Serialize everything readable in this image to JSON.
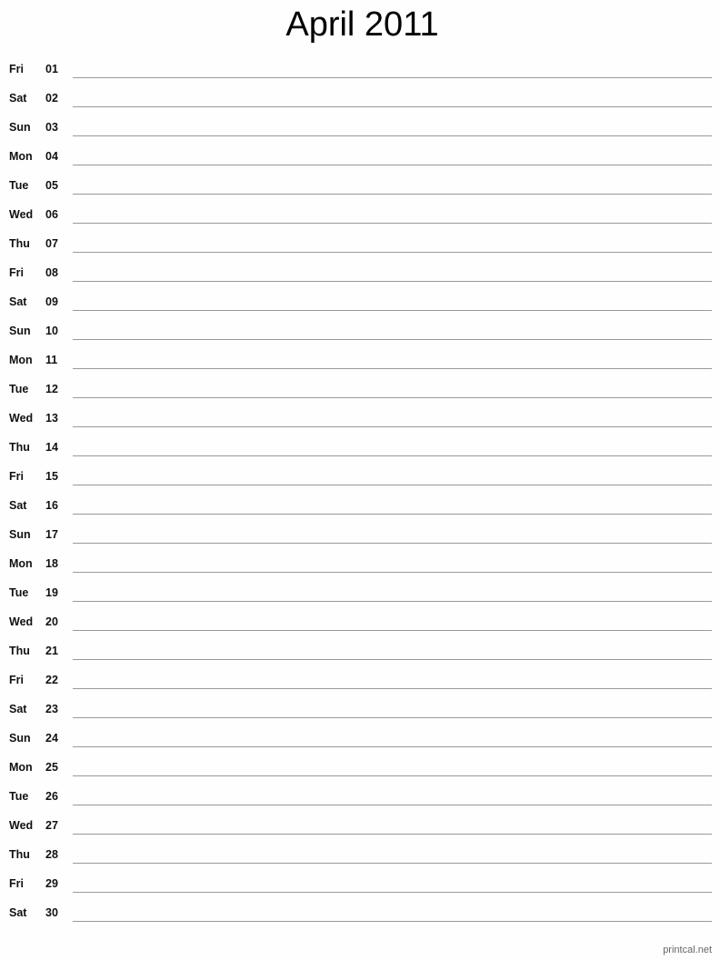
{
  "title": "April 2011",
  "days": [
    {
      "day": "Fri",
      "num": "01"
    },
    {
      "day": "Sat",
      "num": "02"
    },
    {
      "day": "Sun",
      "num": "03"
    },
    {
      "day": "Mon",
      "num": "04"
    },
    {
      "day": "Tue",
      "num": "05"
    },
    {
      "day": "Wed",
      "num": "06"
    },
    {
      "day": "Thu",
      "num": "07"
    },
    {
      "day": "Fri",
      "num": "08"
    },
    {
      "day": "Sat",
      "num": "09"
    },
    {
      "day": "Sun",
      "num": "10"
    },
    {
      "day": "Mon",
      "num": "11"
    },
    {
      "day": "Tue",
      "num": "12"
    },
    {
      "day": "Wed",
      "num": "13"
    },
    {
      "day": "Thu",
      "num": "14"
    },
    {
      "day": "Fri",
      "num": "15"
    },
    {
      "day": "Sat",
      "num": "16"
    },
    {
      "day": "Sun",
      "num": "17"
    },
    {
      "day": "Mon",
      "num": "18"
    },
    {
      "day": "Tue",
      "num": "19"
    },
    {
      "day": "Wed",
      "num": "20"
    },
    {
      "day": "Thu",
      "num": "21"
    },
    {
      "day": "Fri",
      "num": "22"
    },
    {
      "day": "Sat",
      "num": "23"
    },
    {
      "day": "Sun",
      "num": "24"
    },
    {
      "day": "Mon",
      "num": "25"
    },
    {
      "day": "Tue",
      "num": "26"
    },
    {
      "day": "Wed",
      "num": "27"
    },
    {
      "day": "Thu",
      "num": "28"
    },
    {
      "day": "Fri",
      "num": "29"
    },
    {
      "day": "Sat",
      "num": "30"
    }
  ],
  "footer": "printcal.net",
  "colors": {
    "line": "#999999",
    "text": "#111111",
    "background": "#fdfefd"
  }
}
